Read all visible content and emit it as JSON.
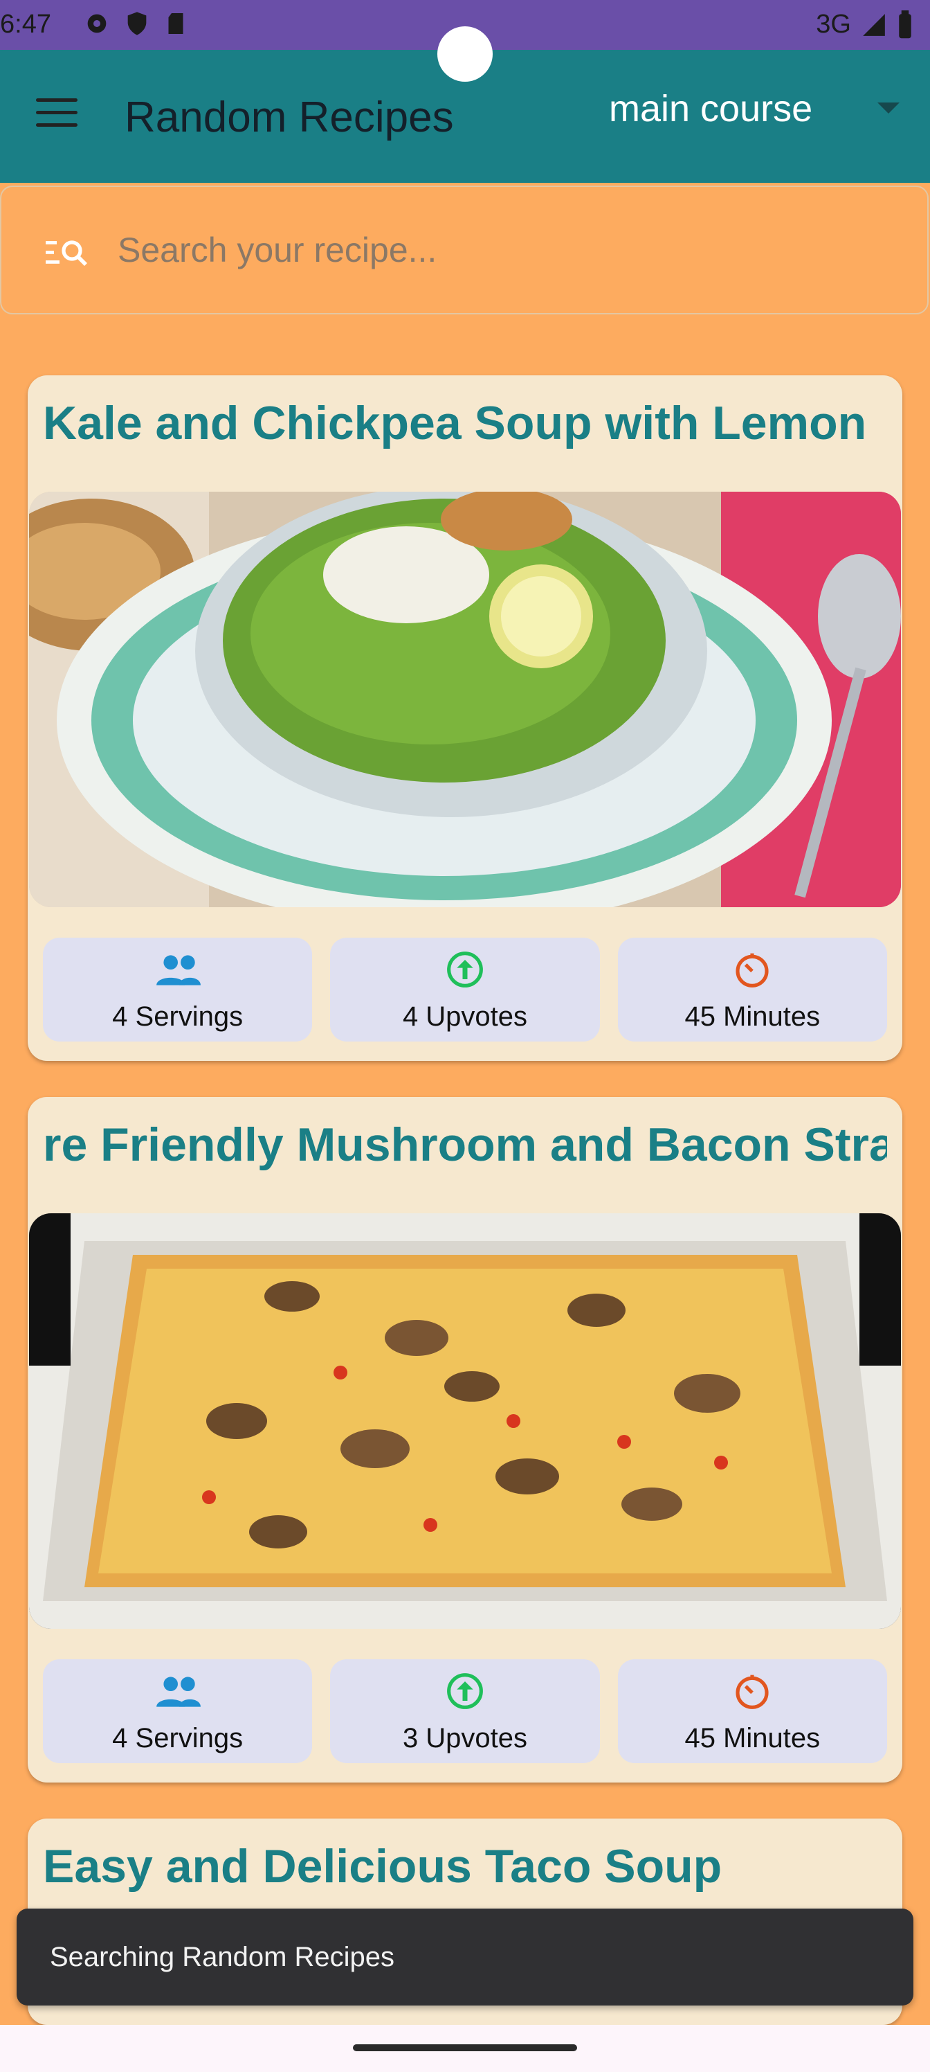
{
  "status_bar": {
    "time": "6:47",
    "network": "3G"
  },
  "app_bar": {
    "title": "Random Recipes",
    "course_filter": {
      "selected": "main course"
    }
  },
  "search": {
    "placeholder": "Search your recipe..."
  },
  "recipes": [
    {
      "title": "Kale and Chickpea Soup with Lemon",
      "servings": "4 Servings",
      "upvotes": "4 Upvotes",
      "time": "45 Minutes"
    },
    {
      "title": "re Friendly Mushroom and Bacon Stra",
      "servings": "4 Servings",
      "upvotes": "3 Upvotes",
      "time": "45 Minutes"
    },
    {
      "title": "Easy and Delicious Taco Soup"
    }
  ],
  "snackbar": {
    "text": "Searching Random Recipes"
  },
  "colors": {
    "app_bar": "#1a7f86",
    "background": "#fdab5f",
    "card": "#f6e8cf",
    "title": "#1a7f86",
    "servings_icon": "#1f8fd1",
    "upvotes_icon": "#1fbf5a",
    "time_icon": "#e2561f"
  },
  "icons": [
    "settings-icon",
    "shield-icon",
    "sd-card-icon",
    "signal-icon",
    "battery-icon",
    "menu-icon",
    "dropdown-arrow-icon",
    "search-list-icon",
    "people-icon",
    "arrow-up-circle-icon",
    "timer-icon"
  ]
}
